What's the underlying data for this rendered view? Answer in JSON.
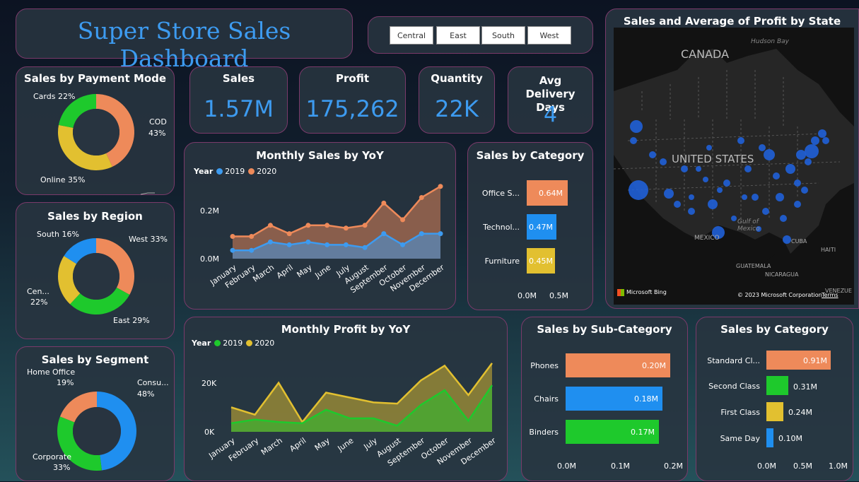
{
  "title": "Super Store Sales Dashboard",
  "slicer": [
    "Central",
    "East",
    "South",
    "West"
  ],
  "kpis": [
    {
      "label": "Sales",
      "value": "1.57M"
    },
    {
      "label": "Profit",
      "value": "175,262"
    },
    {
      "label": "Quantity",
      "value": "22K"
    },
    {
      "label": "Avg Delivery Days",
      "value": "4"
    }
  ],
  "payment": {
    "title": "Sales by Payment Mode",
    "labels": [
      "COD",
      "43%",
      "Online 35%",
      "Cards 22%"
    ]
  },
  "region": {
    "title": "Sales by Region",
    "labels": [
      "West 33%",
      "East 29%",
      "Cen...",
      "22%",
      "South 16%"
    ]
  },
  "segment": {
    "title": "Sales by Segment",
    "labels": [
      "Consu...",
      "48%",
      "Corporate",
      "33%",
      "Home Office",
      "19%"
    ]
  },
  "monthly_sales": {
    "title": "Monthly Sales by YoY",
    "legend_title": "Year",
    "series": [
      "2019",
      "2020"
    ],
    "yticks": [
      "0.2M",
      "0.0M"
    ]
  },
  "months": [
    "January",
    "February",
    "March",
    "April",
    "May",
    "June",
    "July",
    "August",
    "September",
    "October",
    "November",
    "December"
  ],
  "monthly_profit": {
    "title": "Monthly Profit by YoY",
    "legend_title": "Year",
    "series": [
      "2019",
      "2020"
    ],
    "yticks": [
      "20K",
      "0K"
    ]
  },
  "cat": {
    "title": "Sales by Category",
    "rows": [
      {
        "name": "Office S...",
        "value": "0.64M"
      },
      {
        "name": "Technol...",
        "value": "0.47M"
      },
      {
        "name": "Furniture",
        "value": "0.45M"
      }
    ],
    "ticks": [
      "0.0M",
      "0.5M"
    ]
  },
  "subcat": {
    "title": "Sales by Sub-Category",
    "rows": [
      {
        "name": "Phones",
        "value": "0.20M"
      },
      {
        "name": "Chairs",
        "value": "0.18M"
      },
      {
        "name": "Binders",
        "value": "0.17M"
      }
    ],
    "ticks": [
      "0.0M",
      "0.1M",
      "0.2M"
    ]
  },
  "ship": {
    "title": "Sales by Category",
    "rows": [
      {
        "name": "Standard Cl...",
        "value": "0.91M"
      },
      {
        "name": "Second Class",
        "value": "0.31M"
      },
      {
        "name": "First Class",
        "value": "0.24M"
      },
      {
        "name": "Same Day",
        "value": "0.10M"
      }
    ],
    "ticks": [
      "0.0M",
      "0.5M",
      "1.0M"
    ]
  },
  "map": {
    "title": "Sales and Average of Profit by State",
    "labels": [
      "CANADA",
      "UNITED STATES",
      "MEXICO",
      "Hudson Bay",
      "Gulf of Mexico",
      "CUBA",
      "HAITI",
      "GUATEMALA",
      "NICARAGUA",
      "VENEZUE"
    ],
    "credit": "Microsoft Bing",
    "copyright": "© 2023 Microsoft Corporation",
    "terms": "Terms"
  },
  "colors": {
    "accent": "#3d9bf0",
    "orange": "#ee8a5a",
    "green": "#1ec92c",
    "yellow": "#e2c030",
    "blue": "#1f8ff0",
    "card": "#283440",
    "border": "#7a3a6a"
  },
  "chart_data": [
    {
      "type": "pie",
      "title": "Sales by Payment Mode",
      "categories": [
        "COD",
        "Online",
        "Cards"
      ],
      "values": [
        43,
        35,
        22
      ]
    },
    {
      "type": "pie",
      "title": "Sales by Region",
      "categories": [
        "West",
        "East",
        "Central",
        "South"
      ],
      "values": [
        33,
        29,
        22,
        16
      ]
    },
    {
      "type": "pie",
      "title": "Sales by Segment",
      "categories": [
        "Consumer",
        "Corporate",
        "Home Office"
      ],
      "values": [
        48,
        33,
        19
      ]
    },
    {
      "type": "area",
      "title": "Monthly Sales by YoY",
      "categories": [
        "January",
        "February",
        "March",
        "April",
        "May",
        "June",
        "July",
        "August",
        "September",
        "October",
        "November",
        "December"
      ],
      "series": [
        {
          "name": "2019",
          "values": [
            0.03,
            0.03,
            0.06,
            0.05,
            0.06,
            0.05,
            0.05,
            0.04,
            0.09,
            0.05,
            0.09,
            0.09
          ]
        },
        {
          "name": "2020",
          "values": [
            0.08,
            0.08,
            0.12,
            0.09,
            0.12,
            0.12,
            0.11,
            0.12,
            0.2,
            0.14,
            0.22,
            0.26
          ]
        }
      ],
      "ylim": [
        0,
        0.3
      ]
    },
    {
      "type": "area",
      "title": "Monthly Profit by YoY",
      "categories": [
        "January",
        "February",
        "March",
        "April",
        "May",
        "June",
        "July",
        "August",
        "September",
        "October",
        "November",
        "December"
      ],
      "series": [
        {
          "name": "2019",
          "values": [
            3500,
            5000,
            4000,
            3500,
            9000,
            5500,
            5500,
            2500,
            11000,
            17000,
            4500,
            19000
          ]
        },
        {
          "name": "2020",
          "values": [
            10000,
            7000,
            20000,
            4000,
            16000,
            14000,
            12000,
            11500,
            21000,
            27000,
            15000,
            28000
          ]
        }
      ],
      "ylim": [
        0,
        30000
      ]
    },
    {
      "type": "bar",
      "title": "Sales by Category",
      "categories": [
        "Office Supplies",
        "Technology",
        "Furniture"
      ],
      "values": [
        0.64,
        0.47,
        0.45
      ]
    },
    {
      "type": "bar",
      "title": "Sales by Sub-Category",
      "categories": [
        "Phones",
        "Chairs",
        "Binders"
      ],
      "values": [
        0.2,
        0.18,
        0.17
      ]
    },
    {
      "type": "bar",
      "title": "Sales by Category",
      "categories": [
        "Standard Class",
        "Second Class",
        "First Class",
        "Same Day"
      ],
      "values": [
        0.91,
        0.31,
        0.24,
        0.1
      ]
    }
  ]
}
